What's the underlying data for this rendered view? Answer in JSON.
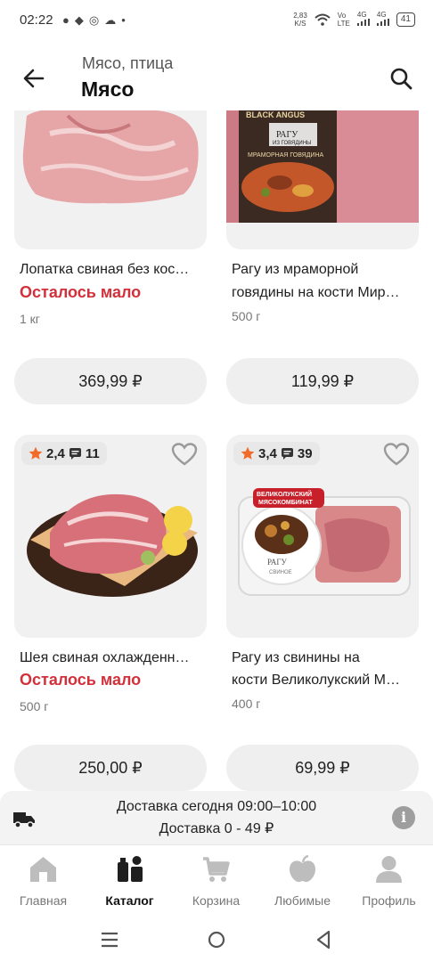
{
  "status_bar": {
    "time": "02:22",
    "net_speed_value": "2,83",
    "net_speed_unit": "K/S",
    "volte_top": "Vo",
    "volte_bottom": "LTE",
    "sig1": "4G",
    "sig2": "4G",
    "battery": "41"
  },
  "header": {
    "breadcrumb": "Мясо, птица",
    "title": "Мясо"
  },
  "products": [
    {
      "name": "Лопатка свиная без кос…",
      "low_stock": "Осталось мало",
      "weight": "1 кг",
      "price": "369,99 ₽"
    },
    {
      "name_line1": "Рагу из мраморной",
      "name_line2": "говядины на кости Мир…",
      "weight": "500 г",
      "price": "119,99 ₽"
    },
    {
      "rating": "2,4",
      "reviews": "11",
      "name": "Шея свиная охлажденн…",
      "low_stock": "Осталось мало",
      "weight": "500 г",
      "price": "250,00 ₽"
    },
    {
      "rating": "3,4",
      "reviews": "39",
      "name_line1": "Рагу из свинины на",
      "name_line2": "кости Великолукский М…",
      "weight": "400 г",
      "price": "69,99 ₽"
    }
  ],
  "package_text": {
    "brand": "BLACK ANGUS",
    "product": "РАГУ",
    "sub": "ИЗ ГОВЯДИНЫ",
    "type": "МРАМОРНАЯ ГОВЯДИНА",
    "vk_brand_1": "ВЕЛИКОЛУКСКИЙ",
    "vk_brand_2": "МЯСОКОМБИНАТ",
    "vk_product": "РАГУ",
    "vk_sub": "СВИНОЕ"
  },
  "delivery": {
    "line1": "Доставка сегодня 09:00–10:00",
    "line2": "Доставка 0 - 49 ₽"
  },
  "nav": {
    "home": "Главная",
    "catalog": "Каталог",
    "cart": "Корзина",
    "favorites": "Любимые",
    "profile": "Профиль"
  },
  "colors": {
    "accent": "#d2303a",
    "star": "#f06a2a",
    "icon_grey": "#bdbdbd",
    "dark": "#1f1f1f"
  },
  "icons": [
    "chat-bubble-icon",
    "message-icon",
    "viber-icon",
    "cloud-upload-icon",
    "wifi-icon",
    "signal-icon",
    "battery-icon",
    "back-arrow-icon",
    "search-icon",
    "star-icon",
    "comment-icon",
    "heart-icon",
    "truck-icon",
    "info-icon",
    "home-icon",
    "catalog-icon",
    "cart-icon",
    "apple-icon",
    "profile-icon",
    "menu-icon",
    "circle-home-icon",
    "triangle-back-icon"
  ]
}
